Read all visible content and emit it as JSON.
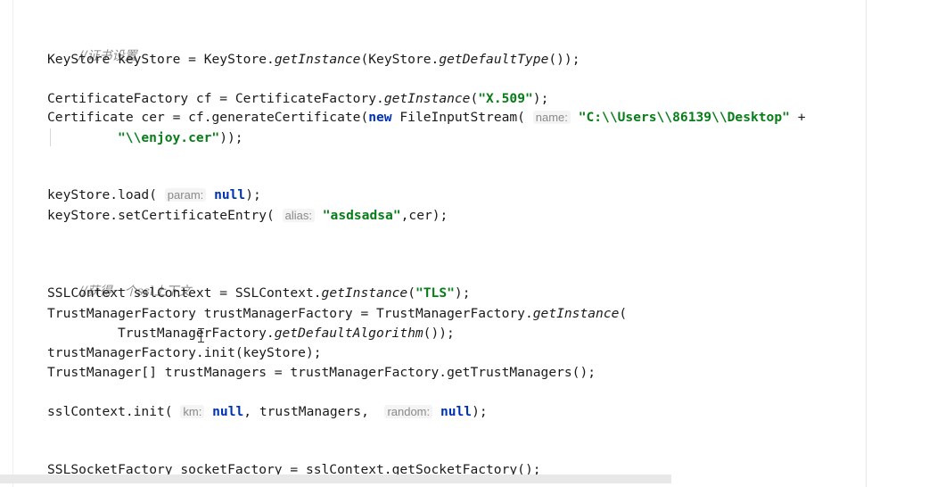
{
  "editor": {
    "lines": {
      "l1": {
        "comment": "//证书设置"
      },
      "l2": {
        "a": "KeyStore keyStore = KeyStore.",
        "b": "getInstance",
        "c": "(KeyStore.",
        "d": "getDefaultType",
        "e": "());"
      },
      "l3": {
        "a": "CertificateFactory cf = CertificateFactory.",
        "b": "getInstance",
        "c": "(",
        "d": "\"X.509\"",
        "e": ");"
      },
      "l4": {
        "a": "Certificate cer = cf.generateCertificate(",
        "kw": "new",
        "b": " FileInputStream( ",
        "hint": "name:",
        "c": " ",
        "str": "\"C:\\\\Users\\\\86139\\\\Desktop\"",
        "d": " +"
      },
      "l5": {
        "str": "\"\\\\enjoy.cer\"",
        "a": "));"
      },
      "l6": {
        "a": "keyStore.load( ",
        "hint": "param:",
        "b": " ",
        "kw": "null",
        "c": ");"
      },
      "l7": {
        "a": "keyStore.setCertificateEntry( ",
        "hint": "alias:",
        "b": " ",
        "str": "\"asdsadsa\"",
        "c": ",cer);"
      },
      "l8": {
        "comment": "//获得一个ssl上下文"
      },
      "l9": {
        "a": "SSLContext sslContext = SSLContext.",
        "b": "getInstance",
        "c": "(",
        "str": "\"TLS\"",
        "d": ");"
      },
      "l10": {
        "a": "TrustManagerFactory trustManagerFactory = TrustManagerFactory.",
        "b": "getInstance",
        "c": "("
      },
      "l11": {
        "a": "TrustManagerFactory.",
        "b": "getDefaultAlgorithm",
        "c": "());"
      },
      "l12": {
        "a": "trustManagerFactory.init(keyStore);"
      },
      "l13": {
        "a": "TrustManager[] trustManagers = trustManagerFactory.getTrustManagers();"
      },
      "l14": {
        "a": "sslContext.init( ",
        "hint1": "km:",
        "b": " ",
        "kw1": "null",
        "c": ", trustManagers,  ",
        "hint2": "random:",
        "d": " ",
        "kw2": "null",
        "e": ");"
      },
      "l15": {
        "a": "SSLSocketFactory socketFactory = sslContext.getSocketFactory();"
      }
    }
  }
}
